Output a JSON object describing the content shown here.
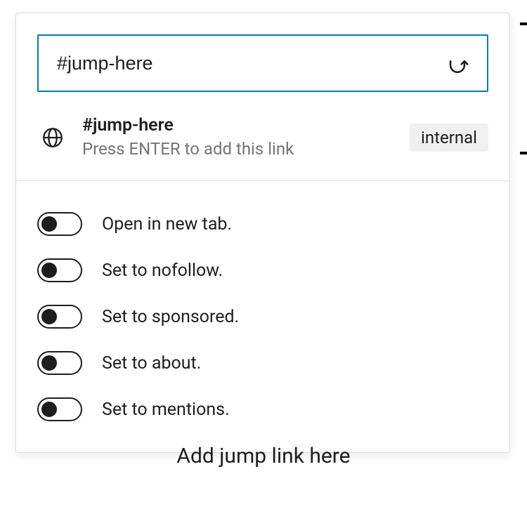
{
  "link_editor": {
    "url_value": "#jump-here",
    "suggestion": {
      "title": "#jump-here",
      "subtitle": "Press ENTER to add this link",
      "badge": "internal"
    },
    "options": [
      {
        "label": "Open in new tab.",
        "checked": false
      },
      {
        "label": "Set to nofollow.",
        "checked": false
      },
      {
        "label": "Set to sponsored.",
        "checked": false
      },
      {
        "label": "Set to about.",
        "checked": false
      },
      {
        "label": "Set to mentions.",
        "checked": false
      }
    ]
  },
  "caption": "Add jump link here"
}
